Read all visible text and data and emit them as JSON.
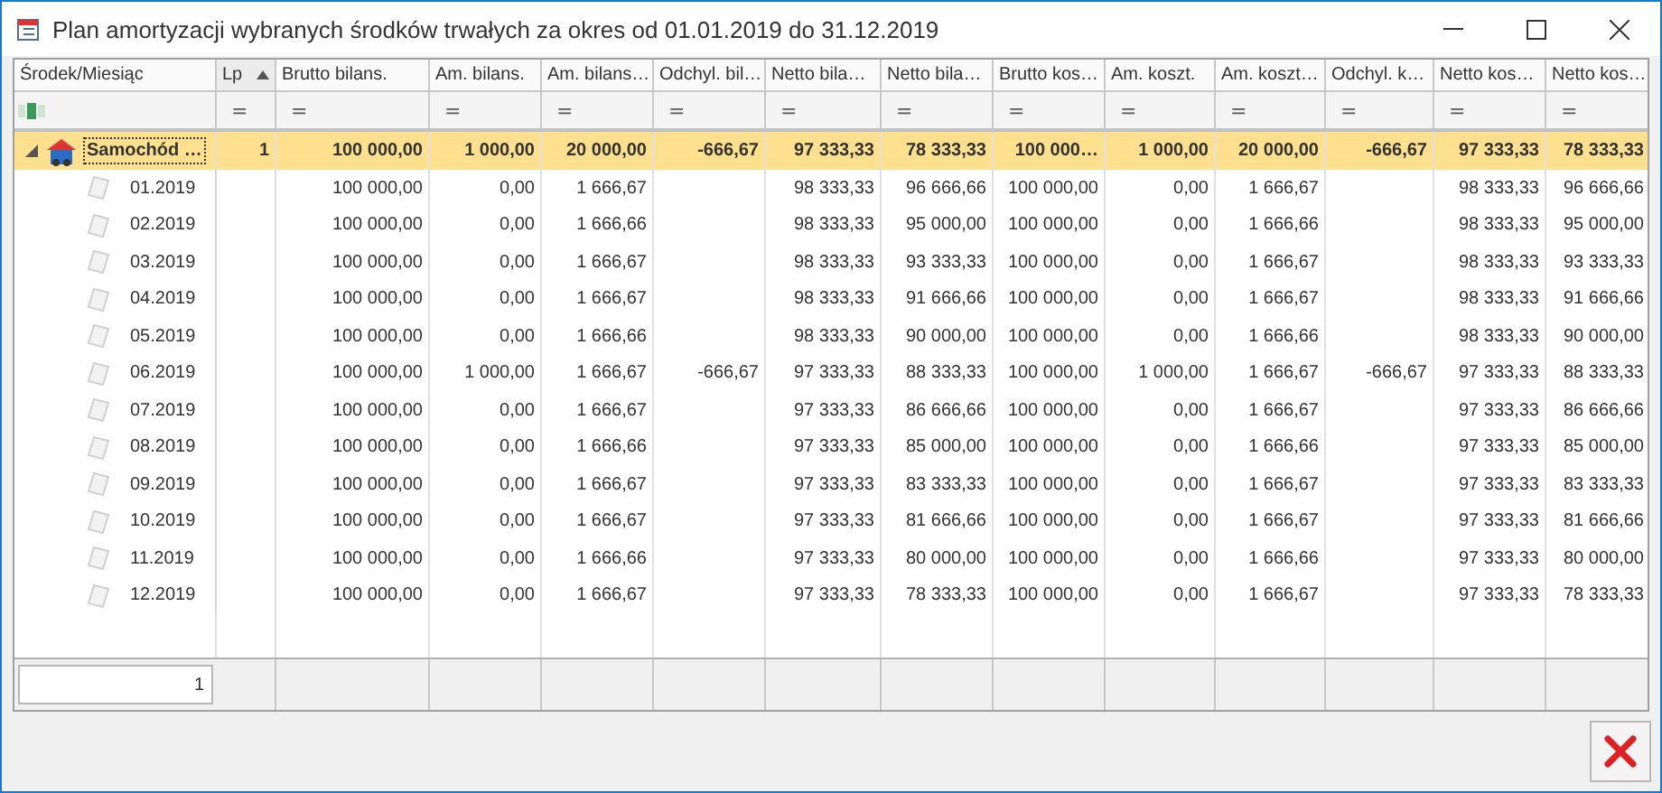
{
  "window": {
    "title": "Plan amortyzacji wybranych środków trwałych za okres od 01.01.2019 do 31.12.2019"
  },
  "table": {
    "columns": [
      {
        "label": "Środek/Miesiąc",
        "sorted": false
      },
      {
        "label": "Lp",
        "sorted": true
      },
      {
        "label": "Brutto bilans.",
        "sorted": false
      },
      {
        "label": "Am. bilans.",
        "sorted": false
      },
      {
        "label": "Am. bilans…",
        "sorted": false
      },
      {
        "label": "Odchyl. bil…",
        "sorted": false
      },
      {
        "label": "Netto bila…",
        "sorted": false
      },
      {
        "label": "Netto bila…",
        "sorted": false
      },
      {
        "label": "Brutto kos…",
        "sorted": false
      },
      {
        "label": "Am. koszt.",
        "sorted": false
      },
      {
        "label": "Am. koszt…",
        "sorted": false
      },
      {
        "label": "Odchyl. k…",
        "sorted": false
      },
      {
        "label": "Netto kos…",
        "sorted": false
      },
      {
        "label": "Netto kos…",
        "sorted": false
      }
    ],
    "filter_symbol": "=",
    "group": {
      "name": "Samochód …",
      "expanded": true,
      "selected": true,
      "cells": [
        "1",
        "100 000,00",
        "1 000,00",
        "20 000,00",
        "-666,67",
        "97 333,33",
        "78 333,33",
        "100 000…",
        "1 000,00",
        "20 000,00",
        "-666,67",
        "97 333,33",
        "78 333,33"
      ],
      "children": [
        {
          "month": "01.2019",
          "cells": [
            null,
            "100 000,00",
            "0,00",
            "1 666,67",
            null,
            "98 333,33",
            "96 666,66",
            "100 000,00",
            "0,00",
            "1 666,67",
            null,
            "98 333,33",
            "96 666,66"
          ]
        },
        {
          "month": "02.2019",
          "cells": [
            null,
            "100 000,00",
            "0,00",
            "1 666,66",
            null,
            "98 333,33",
            "95 000,00",
            "100 000,00",
            "0,00",
            "1 666,66",
            null,
            "98 333,33",
            "95 000,00"
          ]
        },
        {
          "month": "03.2019",
          "cells": [
            null,
            "100 000,00",
            "0,00",
            "1 666,67",
            null,
            "98 333,33",
            "93 333,33",
            "100 000,00",
            "0,00",
            "1 666,67",
            null,
            "98 333,33",
            "93 333,33"
          ]
        },
        {
          "month": "04.2019",
          "cells": [
            null,
            "100 000,00",
            "0,00",
            "1 666,67",
            null,
            "98 333,33",
            "91 666,66",
            "100 000,00",
            "0,00",
            "1 666,67",
            null,
            "98 333,33",
            "91 666,66"
          ]
        },
        {
          "month": "05.2019",
          "cells": [
            null,
            "100 000,00",
            "0,00",
            "1 666,66",
            null,
            "98 333,33",
            "90 000,00",
            "100 000,00",
            "0,00",
            "1 666,66",
            null,
            "98 333,33",
            "90 000,00"
          ]
        },
        {
          "month": "06.2019",
          "cells": [
            null,
            "100 000,00",
            "1 000,00",
            "1 666,67",
            "-666,67",
            "97 333,33",
            "88 333,33",
            "100 000,00",
            "1 000,00",
            "1 666,67",
            "-666,67",
            "97 333,33",
            "88 333,33"
          ]
        },
        {
          "month": "07.2019",
          "cells": [
            null,
            "100 000,00",
            "0,00",
            "1 666,67",
            null,
            "97 333,33",
            "86 666,66",
            "100 000,00",
            "0,00",
            "1 666,67",
            null,
            "97 333,33",
            "86 666,66"
          ]
        },
        {
          "month": "08.2019",
          "cells": [
            null,
            "100 000,00",
            "0,00",
            "1 666,66",
            null,
            "97 333,33",
            "85 000,00",
            "100 000,00",
            "0,00",
            "1 666,66",
            null,
            "97 333,33",
            "85 000,00"
          ]
        },
        {
          "month": "09.2019",
          "cells": [
            null,
            "100 000,00",
            "0,00",
            "1 666,67",
            null,
            "97 333,33",
            "83 333,33",
            "100 000,00",
            "0,00",
            "1 666,67",
            null,
            "97 333,33",
            "83 333,33"
          ]
        },
        {
          "month": "10.2019",
          "cells": [
            null,
            "100 000,00",
            "0,00",
            "1 666,67",
            null,
            "97 333,33",
            "81 666,66",
            "100 000,00",
            "0,00",
            "1 666,67",
            null,
            "97 333,33",
            "81 666,66"
          ]
        },
        {
          "month": "11.2019",
          "cells": [
            null,
            "100 000,00",
            "0,00",
            "1 666,66",
            null,
            "97 333,33",
            "80 000,00",
            "100 000,00",
            "0,00",
            "1 666,66",
            null,
            "97 333,33",
            "80 000,00"
          ]
        },
        {
          "month": "12.2019",
          "cells": [
            null,
            "100 000,00",
            "0,00",
            "1 666,67",
            null,
            "97 333,33",
            "78 333,33",
            "100 000,00",
            "0,00",
            "1 666,67",
            null,
            "97 333,33",
            "78 333,33"
          ]
        }
      ]
    },
    "footer": {
      "count": "1"
    }
  }
}
